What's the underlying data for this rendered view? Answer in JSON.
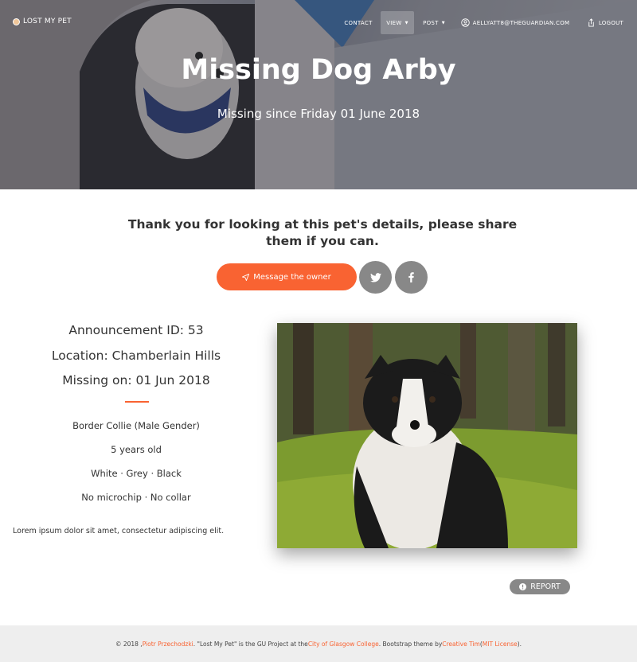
{
  "navbar": {
    "brand": "LOST MY PET",
    "contact": "CONTACT",
    "view": "VIEW",
    "post": "POST",
    "user_email": "AELLYATT8@THEGUARDIAN.COM",
    "logout": "LOGOUT"
  },
  "hero": {
    "title": "Missing Dog Arby",
    "subtitle": "Missing since Friday 01 June 2018"
  },
  "share": {
    "text": "Thank you for looking at this pet's details, please share them if you can.",
    "message_button": "Message the owner",
    "twitter_icon": "twitter-icon",
    "facebook_icon": "facebook-icon"
  },
  "details": {
    "announcement": "Announcement ID: 53",
    "location": "Location: Chamberlain Hills",
    "missing_on": "Missing on: 01 Jun 2018",
    "breed": "Border Collie (Male Gender)",
    "age": "5 years old",
    "colors": "White · Grey · Black",
    "extras": "No microchip · No collar",
    "description": "Lorem ipsum dolor sit amet, consectetur adipiscing elit."
  },
  "report_button": "REPORT",
  "footer": {
    "prefix": "© 2018 , ",
    "author": "Piotr Przechodzki",
    "middle": ". \"Lost My Pet\" is the GU Project at the ",
    "college": "City of Glasgow College",
    "theme_text": ". Bootstrap theme by ",
    "theme_author": "Creative Tim",
    "open_paren": " (",
    "license": "MIT License",
    "close": ")."
  },
  "colors": {
    "accent": "#f96332",
    "grey_button": "#888888",
    "footer_bg": "#eeeeee"
  }
}
